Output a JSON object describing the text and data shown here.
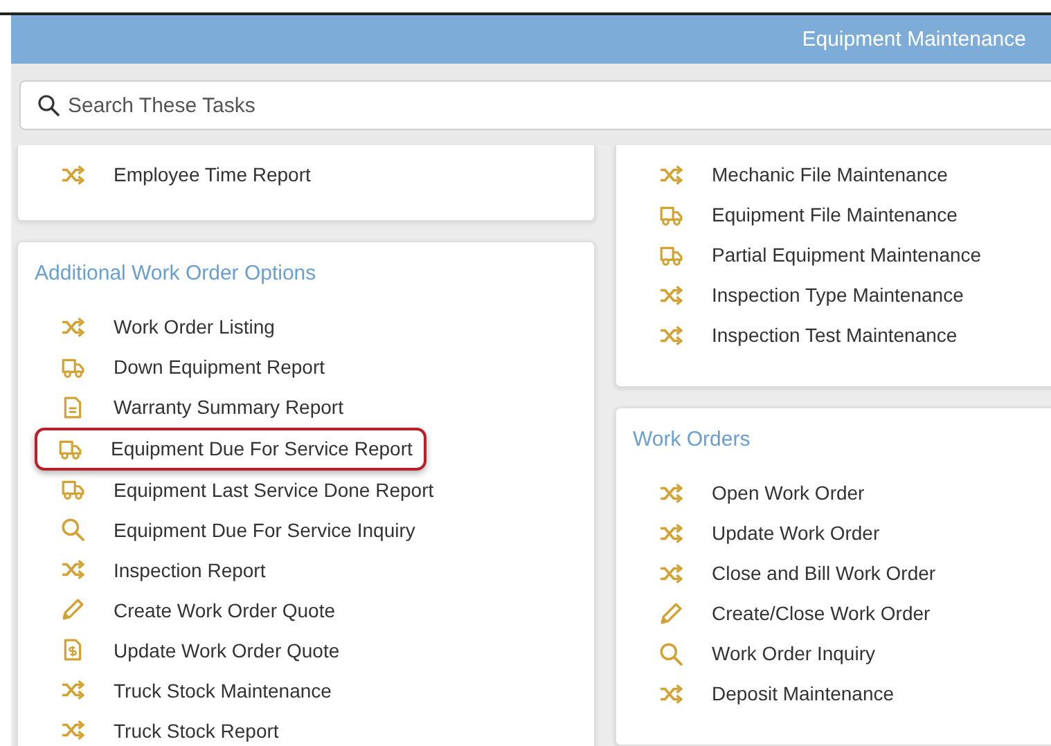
{
  "header": {
    "title": "Equipment Maintenance"
  },
  "search": {
    "placeholder": "Search These Tasks"
  },
  "columns": [
    {
      "cards": [
        {
          "items": [
            {
              "label": "Employee Time Report",
              "kind": "shuffle",
              "highlighted": false
            }
          ]
        },
        {
          "heading": "Additional Work Order Options",
          "items": [
            {
              "label": "Work Order Listing",
              "kind": "shuffle",
              "highlighted": false
            },
            {
              "label": "Down Equipment Report",
              "kind": "truck",
              "highlighted": false
            },
            {
              "label": "Warranty Summary Report",
              "kind": "document",
              "highlighted": false
            },
            {
              "label": "Equipment Due For Service Report",
              "kind": "truck",
              "highlighted": true
            },
            {
              "label": "Equipment Last Service Done Report",
              "kind": "truck",
              "highlighted": false
            },
            {
              "label": "Equipment Due For Service Inquiry",
              "kind": "search",
              "highlighted": false
            },
            {
              "label": "Inspection Report",
              "kind": "shuffle",
              "highlighted": false
            },
            {
              "label": "Create Work Order Quote",
              "kind": "pencil",
              "highlighted": false
            },
            {
              "label": "Update Work Order Quote",
              "kind": "invoice",
              "highlighted": false
            },
            {
              "label": "Truck Stock Maintenance",
              "kind": "shuffle",
              "highlighted": false
            },
            {
              "label": "Truck Stock Report",
              "kind": "shuffle",
              "highlighted": false
            }
          ]
        }
      ]
    },
    {
      "cards": [
        {
          "items": [
            {
              "label": "Mechanic File Maintenance",
              "kind": "shuffle",
              "highlighted": false
            },
            {
              "label": "Equipment File Maintenance",
              "kind": "truck",
              "highlighted": false
            },
            {
              "label": "Partial Equipment Maintenance",
              "kind": "truck",
              "highlighted": false
            },
            {
              "label": "Inspection Type Maintenance",
              "kind": "shuffle",
              "highlighted": false
            },
            {
              "label": "Inspection Test Maintenance",
              "kind": "shuffle",
              "highlighted": false
            }
          ]
        },
        {
          "heading": "Work Orders",
          "items": [
            {
              "label": "Open Work Order",
              "kind": "shuffle",
              "highlighted": false
            },
            {
              "label": "Update Work Order",
              "kind": "shuffle",
              "highlighted": false
            },
            {
              "label": "Close and Bill Work Order",
              "kind": "shuffle",
              "highlighted": false
            },
            {
              "label": "Create/Close Work Order",
              "kind": "pencil",
              "highlighted": false
            },
            {
              "label": "Work Order Inquiry",
              "kind": "search",
              "highlighted": false
            },
            {
              "label": "Deposit Maintenance",
              "kind": "shuffle",
              "highlighted": false
            }
          ]
        }
      ]
    }
  ]
}
